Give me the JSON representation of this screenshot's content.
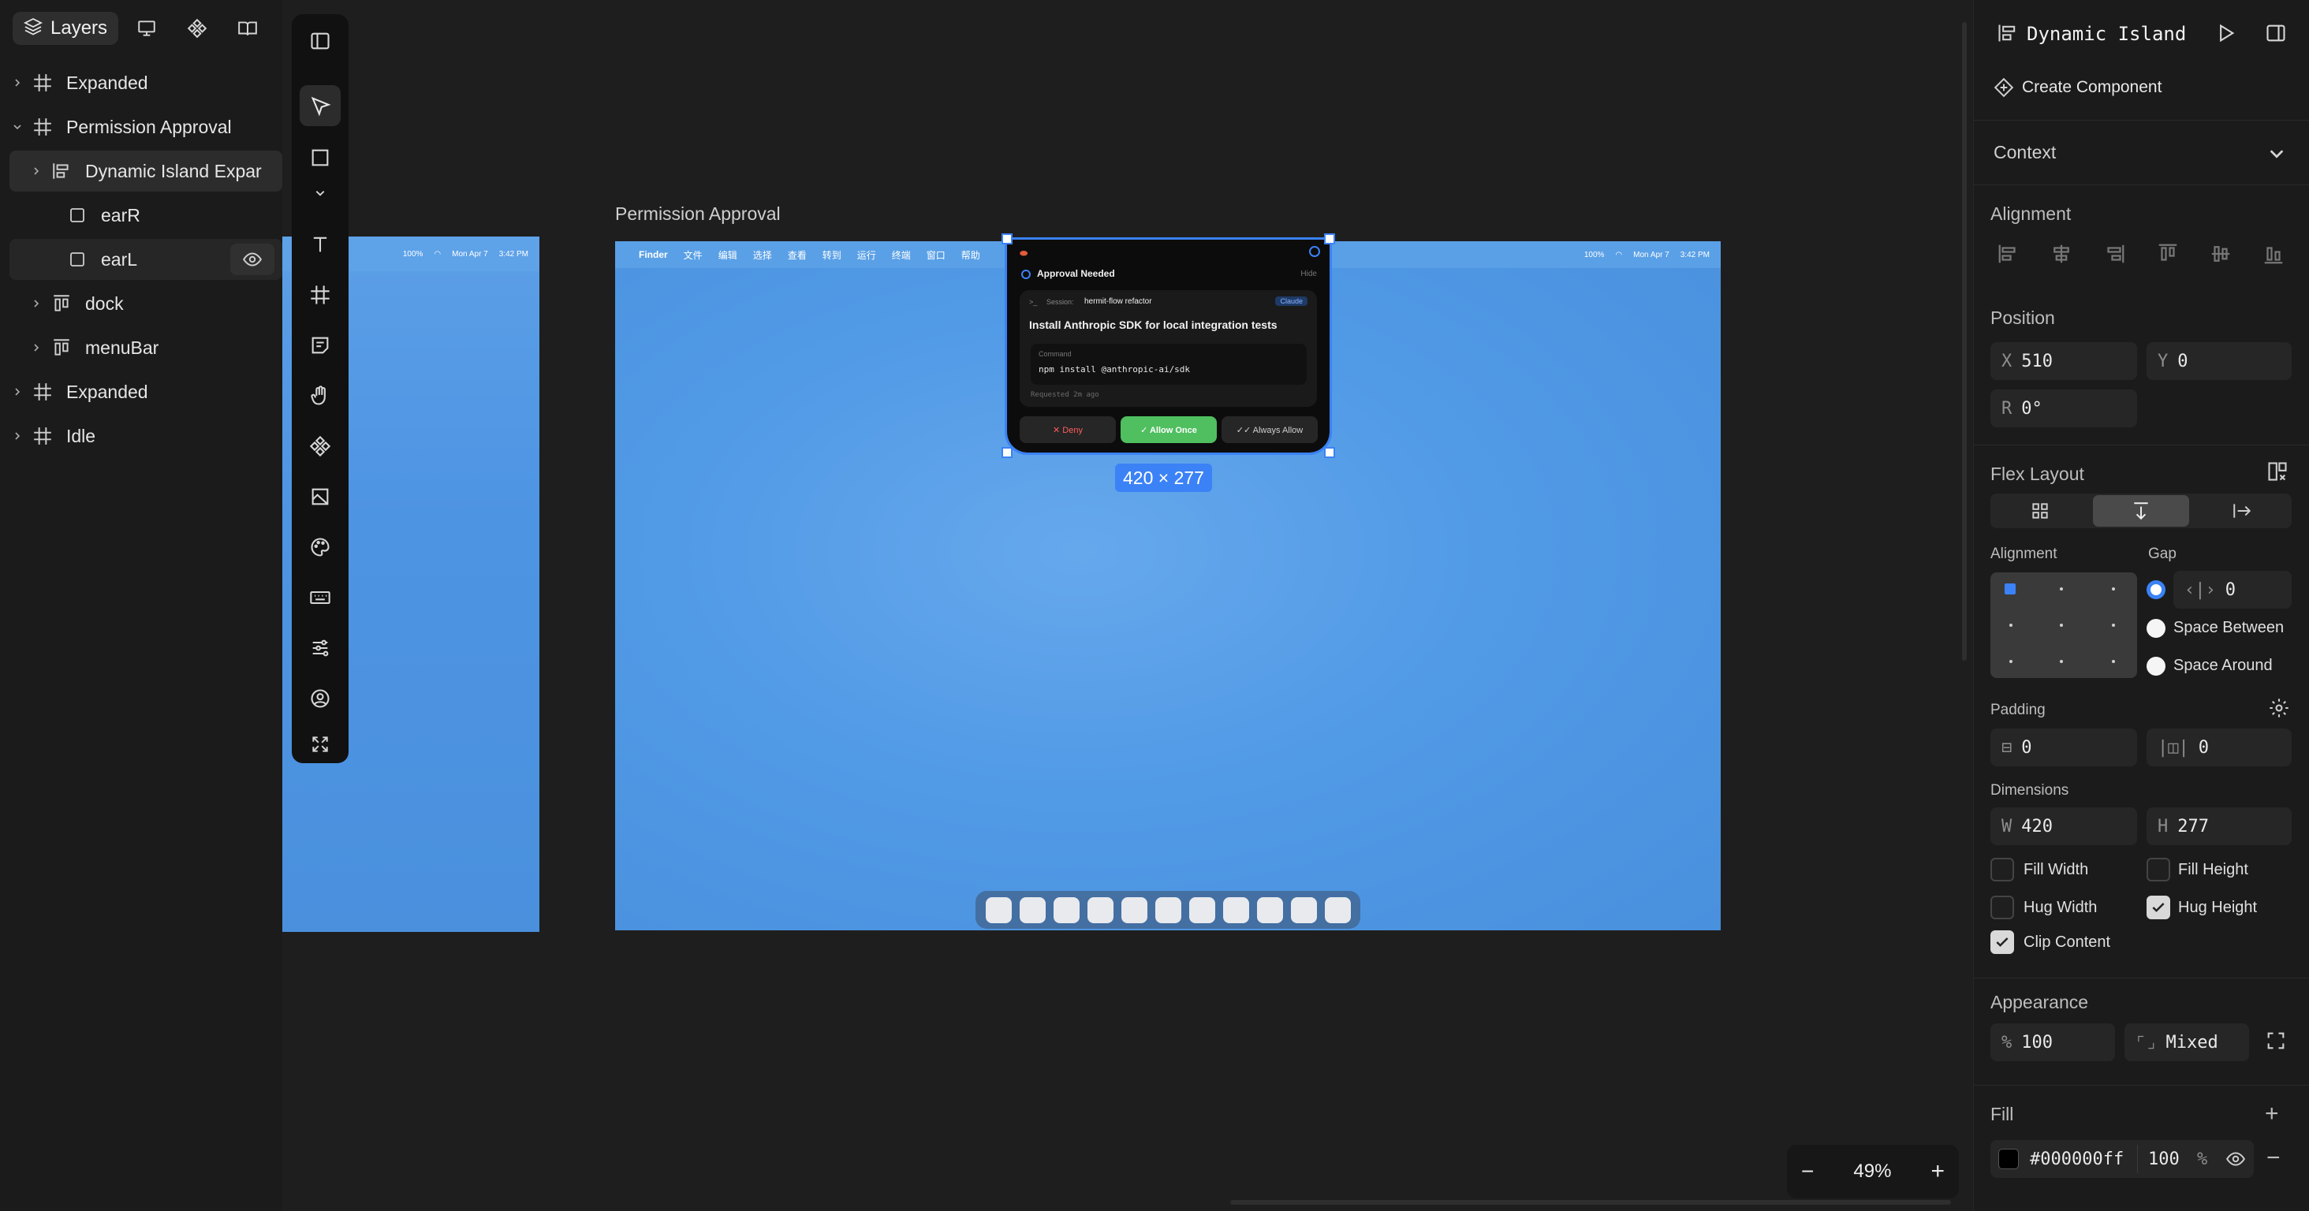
{
  "layers_panel": {
    "tab_label": "Layers",
    "rows": [
      {
        "label": "Expanded",
        "depth": 0,
        "chevron": "right",
        "icon": "frame-icon"
      },
      {
        "label": "Permission Approval",
        "depth": 0,
        "chevron": "down",
        "icon": "frame-icon"
      },
      {
        "label": "Dynamic Island Expar",
        "depth": 1,
        "chevron": "right",
        "icon": "flex-row-icon"
      },
      {
        "label": "earR",
        "depth": 1,
        "chevron": "",
        "icon": "rectangle-icon"
      },
      {
        "label": "earL",
        "depth": 1,
        "chevron": "",
        "icon": "rectangle-icon"
      },
      {
        "label": "dock",
        "depth": 1,
        "chevron": "right",
        "icon": "flex-col-icon"
      },
      {
        "label": "menuBar",
        "depth": 1,
        "chevron": "right",
        "icon": "flex-col-icon"
      },
      {
        "label": "Expanded",
        "depth": 0,
        "chevron": "right",
        "icon": "frame-icon"
      },
      {
        "label": "Idle",
        "depth": 0,
        "chevron": "right",
        "icon": "frame-icon"
      }
    ]
  },
  "canvas": {
    "frame_label": "Permission Approval",
    "left_menubar_right": [
      "100%",
      "Mon Apr 7",
      "3:42 PM"
    ],
    "main_menubar": {
      "items": [
        "Finder",
        "文件",
        "编辑",
        "选择",
        "查看",
        "转到",
        "运行",
        "终端",
        "窗口",
        "帮助"
      ],
      "right": [
        "100%",
        "Mon Apr 7",
        "3:42 PM"
      ]
    },
    "island": {
      "title": "Approval Needed",
      "hide": "Hide",
      "session_label": "Session:",
      "session_value": "hermit-flow refactor",
      "agent_badge": "Claude",
      "request_title": "Install Anthropic SDK for local integration tests",
      "command_label": "Command",
      "command": "npm install @anthropic-ai/sdk",
      "requested": "Requested 2m ago",
      "deny": "✕ Deny",
      "allow_once": "✓ Allow Once",
      "always_allow": "✓✓ Always Allow"
    },
    "dimension_badge": "420 × 277",
    "dock_app_count": 11,
    "zoom": "49%"
  },
  "inspector": {
    "title": "Dynamic Island",
    "create_component": "Create Component",
    "context": "Context",
    "alignment": "Alignment",
    "position": "Position",
    "x_label": "X",
    "x_value": "510",
    "y_label": "Y",
    "y_value": "0",
    "r_label": "R",
    "r_value": "0°",
    "flex_layout": "Flex Layout",
    "flex_alignment": "Alignment",
    "gap": "Gap",
    "gap_value": "0",
    "space_between": "Space Between",
    "space_around": "Space Around",
    "padding": "Padding",
    "padding_h": "0",
    "padding_v": "0",
    "dimensions": "Dimensions",
    "w_label": "W",
    "w_value": "420",
    "h_label": "H",
    "h_value": "277",
    "fill_width": "Fill Width",
    "fill_height": "Fill Height",
    "hug_width": "Hug Width",
    "hug_height": "Hug Height",
    "clip_content": "Clip Content",
    "appearance": "Appearance",
    "opacity_prefix": "%",
    "opacity_value": "100",
    "radius_value": "Mixed",
    "fill": "Fill",
    "fill_hex": "#000000ff",
    "fill_opacity": "100",
    "fill_opacity_unit": "%"
  },
  "colors": {
    "accent": "#3b82f6",
    "allow_green": "#4fbf5f",
    "deny_red": "#ff5b5b",
    "desktop_blue": "#4d94e3"
  }
}
